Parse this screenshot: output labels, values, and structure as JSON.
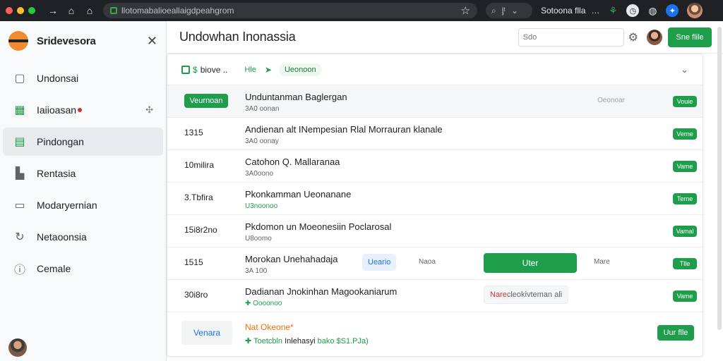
{
  "browser": {
    "url": "llotomabalioeallaigdpeahgrom",
    "search_label": "ᶅᵗ",
    "tab_title": "Sotoona flla",
    "ext_dots": "…",
    "colors": {
      "red": "#ff5f57",
      "yellow": "#febc2e",
      "green": "#28c840"
    }
  },
  "sidebar": {
    "brand": "Sridevesora",
    "items": [
      {
        "label": "Undonsai",
        "icon": "clipboard-icon"
      },
      {
        "label": "Iaiioasan",
        "icon": "grid-icon"
      },
      {
        "label": "Pindongan",
        "icon": "document-icon"
      },
      {
        "label": "Rentasia",
        "icon": "building-icon"
      },
      {
        "label": "Modaryernian",
        "icon": "window-icon"
      },
      {
        "label": "Netaoonsia",
        "icon": "refresh-icon"
      },
      {
        "label": "Cemale",
        "icon": "info-icon"
      }
    ]
  },
  "main": {
    "title": "Undowhan Inonassia",
    "search_placeholder": "Sdo",
    "header_button": "Sne flile",
    "filter": {
      "label": "biove ..",
      "chip1": "Hle",
      "chip2": "Ueonoon"
    },
    "rows": [
      {
        "lead": "Veurnoan",
        "title": "Unduntanman Baglergan",
        "sub": "3A0 oonan",
        "ghost": "Oeonoar",
        "status": "Vouie"
      },
      {
        "lead": "1315",
        "title": "Andienan alt INempesian Rlal Morrauran klanale",
        "sub": "3A0 oonay",
        "status": "Verne"
      },
      {
        "lead": "10milira",
        "title": "Catohon Q. Mallaranaa",
        "sub": "3A0oono",
        "status": "Vame"
      },
      {
        "lead": "3.Tbfira",
        "title": "Pkonkamman Ueonanane",
        "sub": "U3noonoo",
        "status": "Terne"
      },
      {
        "lead": "15i8r2no",
        "title": "Pkdomon un Moeonesiin Poclarosal",
        "sub": "U8oomo",
        "status": "Vamal"
      },
      {
        "lead": "1515",
        "title": "Morokan Unehahadaja",
        "sub": "3A 100",
        "pill": "Ueario",
        "mid": "Naoa",
        "button": "Uter",
        "mid2": "Mare",
        "status": "Tlle"
      },
      {
        "lead": "30i8ro",
        "title": "Dadianan Jnokinhan Magookaniarum",
        "sub": "Oooonoo",
        "tag_red": "Nare",
        "tag_rest": "cleokivteman ali",
        "status": "Vame"
      }
    ],
    "footer": {
      "button": "Venara",
      "title": "Nat Okeone",
      "sub_green": "Toetcbln",
      "sub_dark": "Inlehasyi",
      "sub_tail": "bako $S1.PJa)",
      "action": "Uur flle"
    }
  }
}
